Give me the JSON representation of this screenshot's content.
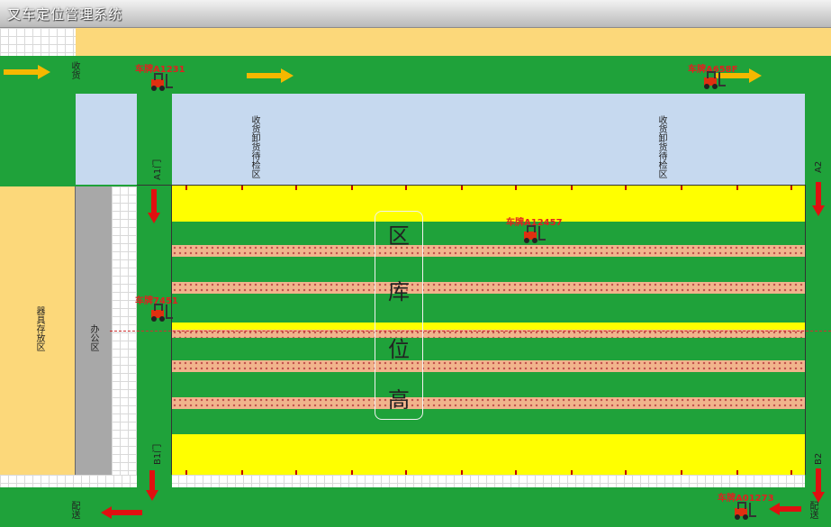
{
  "window": {
    "title": "叉车定位管理系统"
  },
  "zones": {
    "receiving_inspection_left": "收货卸货待检区",
    "receiving_inspection_right": "收货卸货待检区",
    "tool_storage": "器具存放区",
    "office": "办公区",
    "high_rack": [
      "高",
      "位",
      "库",
      "区"
    ]
  },
  "doors": {
    "a1": "A1门",
    "a2": "A2",
    "b1": "B1门",
    "b2": "B2"
  },
  "areas": {
    "receiving": "收货",
    "delivery_left": "配送",
    "delivery_right": "配送"
  },
  "forklifts": [
    {
      "label": "车牌A1231"
    },
    {
      "label": "车牌A658F"
    },
    {
      "label": "车牌A12457"
    },
    {
      "label": "车牌7451"
    },
    {
      "label": "车牌A01273"
    }
  ],
  "colors": {
    "floor": "#1fa23a",
    "aisle_yellow": "#ffff00",
    "rack": "#f1b48c",
    "inspection_zone": "#c6d9ef",
    "storage_zone": "#fcd87a",
    "arrow_yellow": "#f5b800",
    "arrow_red": "#e01010"
  }
}
